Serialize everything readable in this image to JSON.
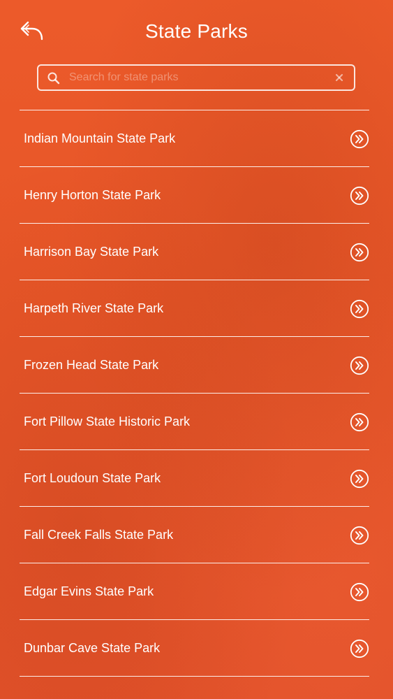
{
  "header": {
    "title": "State Parks",
    "back_icon": "back-arrow-icon"
  },
  "search": {
    "placeholder": "Search for state parks",
    "value": "",
    "search_icon": "search-icon",
    "clear_icon": "close-icon"
  },
  "parks": [
    {
      "label": "Indian Mountain State Park"
    },
    {
      "label": "Henry Horton State Park"
    },
    {
      "label": "Harrison Bay State Park"
    },
    {
      "label": "Harpeth River State Park"
    },
    {
      "label": "Frozen Head State Park"
    },
    {
      "label": "Fort Pillow State Historic Park"
    },
    {
      "label": "Fort Loudoun State Park"
    },
    {
      "label": "Fall Creek Falls State Park"
    },
    {
      "label": "Edgar Evins State Park"
    },
    {
      "label": "Dunbar Cave State Park"
    }
  ],
  "item_icon": "double-chevron-right-circle-icon",
  "colors": {
    "background": "#e75628",
    "foreground": "#ffffff"
  }
}
